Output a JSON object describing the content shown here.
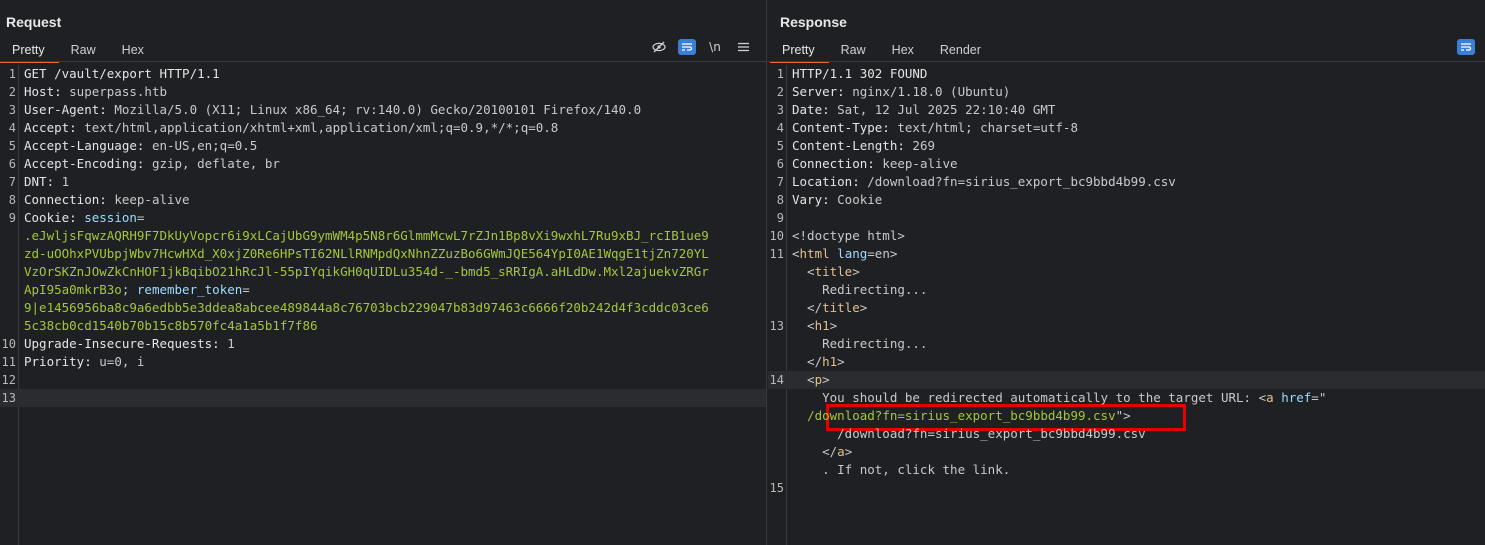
{
  "request": {
    "title": "Request",
    "tabs": [
      "Pretty",
      "Raw",
      "Hex"
    ],
    "newline_label": "\\n",
    "lines": [
      {
        "n": "1",
        "parts": [
          [
            "k",
            "GET /vault/export HTTP/1.1"
          ]
        ]
      },
      {
        "n": "2",
        "parts": [
          [
            "k",
            "Host: "
          ],
          [
            "v",
            "superpass.htb"
          ]
        ]
      },
      {
        "n": "3",
        "parts": [
          [
            "k",
            "User-Agent: "
          ],
          [
            "v",
            "Mozilla/5.0 (X11; Linux x86_64; rv:140.0) Gecko/20100101 Firefox/140.0"
          ]
        ]
      },
      {
        "n": "4",
        "parts": [
          [
            "k",
            "Accept: "
          ],
          [
            "v",
            "text/html,application/xhtml+xml,application/xml;q=0.9,*/*;q=0.8"
          ]
        ]
      },
      {
        "n": "5",
        "parts": [
          [
            "k",
            "Accept-Language: "
          ],
          [
            "v",
            "en-US,en;q=0.5"
          ]
        ]
      },
      {
        "n": "6",
        "parts": [
          [
            "k",
            "Accept-Encoding: "
          ],
          [
            "v",
            "gzip, deflate, br"
          ]
        ]
      },
      {
        "n": "7",
        "parts": [
          [
            "k",
            "DNT: "
          ],
          [
            "v",
            "1"
          ]
        ]
      },
      {
        "n": "8",
        "parts": [
          [
            "k",
            "Connection: "
          ],
          [
            "v",
            "keep-alive"
          ]
        ]
      },
      {
        "n": "9",
        "parts": [
          [
            "k",
            "Cookie: "
          ],
          [
            "attr",
            "session"
          ],
          [
            "v",
            "="
          ]
        ]
      },
      {
        "n": "",
        "parts": [
          [
            "g",
            ".eJwljsFqwzAQRH9F7DkUyVopcr6i9xLCajUbG9ymWM4p5N8r6GlmmMcwL7rZJn1Bp8vXi9wxhL7Ru9xBJ_rcIB1ue9"
          ]
        ]
      },
      {
        "n": "",
        "parts": [
          [
            "g",
            "zd-uOOhxPVUbpjWbv7HcwHXd_X0xjZ0Re6HPsTI62NLlRNMpdQxNhnZZuzBo6GWmJQE564YpI0AE1WqgE1tjZn720YL"
          ]
        ]
      },
      {
        "n": "",
        "parts": [
          [
            "g",
            "VzOrSKZnJOwZkCnHOF1jkBqibO21hRcJl-55pIYqikGH0qUIDLu354d-_-bmd5_sRRIgA.aHLdDw.Mxl2ajuekvZRGr"
          ]
        ]
      },
      {
        "n": "",
        "parts": [
          [
            "g",
            "ApI95a0mkrB3o"
          ],
          [
            "v",
            "; "
          ],
          [
            "attr",
            "remember_token"
          ],
          [
            "v",
            "="
          ]
        ]
      },
      {
        "n": "",
        "parts": [
          [
            "g",
            "9|e1456956ba8c9a6edbb5e3ddea8abcee489844a8c76703bcb229047b83d97463c6666f20b242d4f3cddc03ce6"
          ]
        ]
      },
      {
        "n": "",
        "parts": [
          [
            "g",
            "5c38cb0cd1540b70b15c8b570fc4a1a5b1f7f86"
          ]
        ]
      },
      {
        "n": "10",
        "parts": [
          [
            "k",
            "Upgrade-Insecure-Requests: "
          ],
          [
            "v",
            "1"
          ]
        ]
      },
      {
        "n": "11",
        "parts": [
          [
            "k",
            "Priority: "
          ],
          [
            "v",
            "u=0, i"
          ]
        ]
      },
      {
        "n": "12",
        "parts": []
      },
      {
        "n": "13",
        "parts": [],
        "cur": true
      }
    ]
  },
  "response": {
    "title": "Response",
    "tabs": [
      "Pretty",
      "Raw",
      "Hex",
      "Render"
    ],
    "lines": [
      {
        "n": "1",
        "parts": [
          [
            "k",
            "HTTP/1.1 302 FOUND"
          ]
        ]
      },
      {
        "n": "2",
        "parts": [
          [
            "k",
            "Server: "
          ],
          [
            "v",
            "nginx/1.18.0 (Ubuntu)"
          ]
        ]
      },
      {
        "n": "3",
        "parts": [
          [
            "k",
            "Date: "
          ],
          [
            "v",
            "Sat, 12 Jul 2025 22:10:40 GMT"
          ]
        ]
      },
      {
        "n": "4",
        "parts": [
          [
            "k",
            "Content-Type: "
          ],
          [
            "v",
            "text/html; charset=utf-8"
          ]
        ]
      },
      {
        "n": "5",
        "parts": [
          [
            "k",
            "Content-Length: "
          ],
          [
            "v",
            "269"
          ]
        ]
      },
      {
        "n": "6",
        "parts": [
          [
            "k",
            "Connection: "
          ],
          [
            "v",
            "keep-alive"
          ]
        ]
      },
      {
        "n": "7",
        "parts": [
          [
            "k",
            "Location: "
          ],
          [
            "v",
            "/download?fn=sirius_export_bc9bbd4b99.csv"
          ]
        ]
      },
      {
        "n": "8",
        "parts": [
          [
            "k",
            "Vary: "
          ],
          [
            "v",
            "Cookie"
          ]
        ]
      },
      {
        "n": "9",
        "parts": []
      },
      {
        "n": "10",
        "parts": [
          [
            "v",
            "<!doctype html>"
          ]
        ]
      },
      {
        "n": "11",
        "parts": [
          [
            "v",
            "<"
          ],
          [
            "tagc",
            "html"
          ],
          [
            "v",
            " "
          ],
          [
            "attr",
            "lang"
          ],
          [
            "v",
            "=en>"
          ]
        ]
      },
      {
        "n": "",
        "parts": [
          [
            "v",
            "  <"
          ],
          [
            "tagc",
            "title"
          ],
          [
            "v",
            ">"
          ]
        ]
      },
      {
        "n": "",
        "parts": [
          [
            "v",
            "    Redirecting..."
          ]
        ]
      },
      {
        "n": "",
        "parts": [
          [
            "v",
            "  </"
          ],
          [
            "tagc",
            "title"
          ],
          [
            "v",
            ">"
          ]
        ]
      },
      {
        "n": "13",
        "parts": [
          [
            "v",
            "  <"
          ],
          [
            "tagc",
            "h1"
          ],
          [
            "v",
            ">"
          ]
        ]
      },
      {
        "n": "",
        "parts": [
          [
            "v",
            "    Redirecting..."
          ]
        ]
      },
      {
        "n": "",
        "parts": [
          [
            "v",
            "  </"
          ],
          [
            "tagc",
            "h1"
          ],
          [
            "v",
            ">"
          ]
        ]
      },
      {
        "n": "14",
        "parts": [
          [
            "v",
            "  <"
          ],
          [
            "tagc",
            "p"
          ],
          [
            "v",
            ">"
          ]
        ],
        "cur": true
      },
      {
        "n": "",
        "parts": [
          [
            "v",
            "    You should be redirected automatically to the target URL: <"
          ],
          [
            "tagc",
            "a"
          ],
          [
            "v",
            " "
          ],
          [
            "attr",
            "href"
          ],
          [
            "v",
            "=\""
          ]
        ]
      },
      {
        "n": "",
        "parts": [
          [
            "v",
            "  "
          ],
          [
            "g",
            "/download?fn=sirius_export_bc9bbd4b99.csv"
          ],
          [
            "v",
            "\">"
          ]
        ]
      },
      {
        "n": "",
        "parts": [
          [
            "v",
            "      /download?fn=sirius_export_bc9bbd4b99.csv"
          ]
        ]
      },
      {
        "n": "",
        "parts": [
          [
            "v",
            "    </"
          ],
          [
            "tagc",
            "a"
          ],
          [
            "v",
            ">"
          ]
        ]
      },
      {
        "n": "",
        "parts": [
          [
            "v",
            "    . If not, click the link."
          ]
        ]
      },
      {
        "n": "15",
        "parts": []
      }
    ]
  }
}
